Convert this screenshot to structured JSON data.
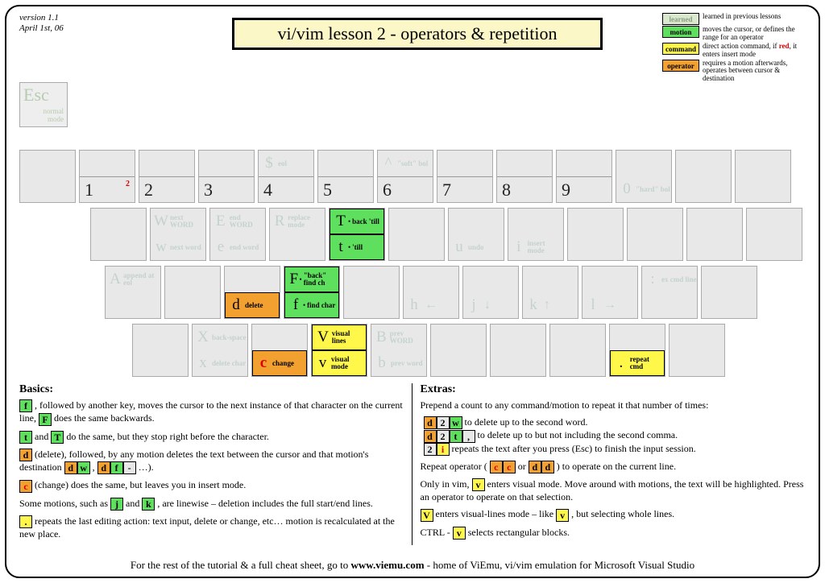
{
  "meta": {
    "version": "version 1.1",
    "date": "April 1st, 06"
  },
  "title": "vi/vim lesson 2 - operators & repetition",
  "legend": {
    "learned": {
      "swatch": "learned",
      "text": "learned in previous lessons"
    },
    "motion": {
      "swatch": "motion",
      "text": "moves the cursor, or defines the range for an operator"
    },
    "command": {
      "swatch": "command",
      "text_a": "direct action command, if ",
      "text_red": "red",
      "text_b": ", it enters insert mode"
    },
    "operator": {
      "swatch": "operator",
      "text": "requires a motion afterwards, operates between cursor & destination"
    }
  },
  "esc": {
    "big": "Esc",
    "small1": "normal",
    "small2": "mode"
  },
  "row1": {
    "tilde": {
      "top": "",
      "bot": ""
    },
    "k1": {
      "digit": "1",
      "red2": "2"
    },
    "k2": {
      "digit": "2"
    },
    "k3": {
      "digit": "3"
    },
    "k4": {
      "digit": "4",
      "ghost_top_l": "$",
      "ghost_top_t": "eol"
    },
    "k5": {
      "digit": "5"
    },
    "k6": {
      "digit": "6",
      "ghost_top_l": "^",
      "ghost_top_t": "\"soft\" bol"
    },
    "k7": {
      "digit": "7"
    },
    "k8": {
      "digit": "8"
    },
    "k9": {
      "digit": "9"
    },
    "k0": {
      "digit": "",
      "ghost_bot_l": "0",
      "ghost_bot_t": "\"hard\" bol"
    },
    "dash": {},
    "eq": {}
  },
  "row2": {
    "Q": {},
    "W": {
      "ghost_top_l": "W",
      "ghost_top_t": "next WORD",
      "ghost_bot_l": "w",
      "ghost_bot_t": "next word"
    },
    "E": {
      "ghost_top_l": "E",
      "ghost_top_t": "end WORD",
      "ghost_bot_l": "e",
      "ghost_bot_t": "end word"
    },
    "R": {
      "ghost_top_l": "R",
      "ghost_top_t": "replace mode"
    },
    "T": {
      "top_l": "T",
      "top_t": "back 'till",
      "top_cls": "motion",
      "top_dot": "•",
      "bot_l": "t",
      "bot_t": "'till",
      "bot_cls": "motion",
      "bot_dot": "•"
    },
    "Y": {},
    "U": {
      "ghost_bot_l": "u",
      "ghost_bot_t": "undo"
    },
    "I": {
      "ghost_bot_l": "i",
      "ghost_bot_t": "insert mode"
    },
    "O": {},
    "P": {},
    "br1": {},
    "br2": {}
  },
  "row3": {
    "A": {
      "ghost_top_l": "A",
      "ghost_top_t": "append at eol"
    },
    "S": {},
    "D": {
      "bot_l": "d",
      "bot_t": "delete",
      "bot_cls": "operator"
    },
    "F": {
      "top_l": "F",
      "top_t": "\"back\" find ch",
      "top_cls": "motion",
      "top_dot": "•",
      "bot_l": "f",
      "bot_t": "find char",
      "bot_cls": "motion",
      "bot_dot": "•"
    },
    "G": {},
    "H": {
      "ghost_bot_l": "h",
      "arrow": "←"
    },
    "J": {
      "ghost_bot_l": "j",
      "arrow": "↓"
    },
    "K": {
      "ghost_bot_l": "k",
      "arrow": "↑"
    },
    "L": {
      "ghost_bot_l": "l",
      "arrow": "→"
    },
    "semi": {
      "ghost_top_l": ":",
      "ghost_top_t": "ex cmd line"
    },
    "quote": {}
  },
  "row4": {
    "Z": {},
    "X": {
      "ghost_top_l": "X",
      "ghost_top_t": "back-space",
      "ghost_bot_l": "x",
      "ghost_bot_t": "delete char"
    },
    "C": {
      "bot_l": "c",
      "bot_t": "change",
      "bot_cls": "operator",
      "bot_red": true
    },
    "V": {
      "top_l": "V",
      "top_t": "visual lines",
      "top_cls": "command",
      "bot_l": "v",
      "bot_t": "visual mode",
      "bot_cls": "command"
    },
    "B": {
      "ghost_top_l": "B",
      "ghost_top_t": "prev WORD",
      "ghost_bot_l": "b",
      "ghost_bot_t": "prev word"
    },
    "N": {},
    "M": {},
    "comma": {},
    "dot": {
      "bot_l": ".",
      "bot_t": "repeat cmd",
      "bot_cls": "command"
    },
    "slash": {}
  },
  "basics": {
    "h": "Basics:",
    "p1a": " , followed by another key, moves the cursor  to the next instance of that character on the current line, ",
    "p1b": " does the same backwards.",
    "p2a": " and ",
    "p2b": " do the same, but they stop right before the character.",
    "p3a": " (delete), followed, by any motion deletes the text between the cursor and that motion's destination ",
    "p3b": " , ",
    "p3c": " …).",
    "p4": " (change) does the same, but leaves you in insert mode.",
    "p5a": "Some motions, such as ",
    "p5b": " and ",
    "p5c": " , are linewise – deletion includes the  full start/end lines.",
    "p6": " repeats the last editing action: text input, delete or change, etc… motion is recalculated at the new place."
  },
  "extras": {
    "h": "Extras:",
    "p1": "Prepend a count to any command/motion to repeat it that number of times:",
    "l1": " to delete up to the second word.",
    "l2": " to delete up to but not including the second comma.",
    "l3": " repeats the text after you press (Esc) to finish the input session.",
    "p2a": "Repeat operator ( ",
    "p2b": " or ",
    "p2c": " ) to operate on the current line.",
    "p3a": "Only in vim, ",
    "p3b": " enters visual mode. Move around with motions, the text will be highlighted. Press an operator to operate on that selection.",
    "p4a": " enters visual-lines mode – like ",
    "p4b": " , but selecting whole lines.",
    "p5a": "CTRL - ",
    "p5b": " selects rectangular blocks."
  },
  "chips": {
    "f": "f",
    "F": "F",
    "t": "t",
    "T": "T",
    "d": "d",
    "w": "w",
    "dash": "-",
    "c": "c",
    "j": "j",
    "k": "k",
    "dot": ".",
    "2": "2",
    "i": "i",
    "comma": ",",
    "v": "v",
    "V": "V"
  },
  "footer": {
    "a": "For the rest of the tutorial & a full cheat sheet, go to ",
    "b": "www.viemu.com",
    "c": " - home of ViEmu, vi/vim emulation for Microsoft Visual Studio"
  }
}
